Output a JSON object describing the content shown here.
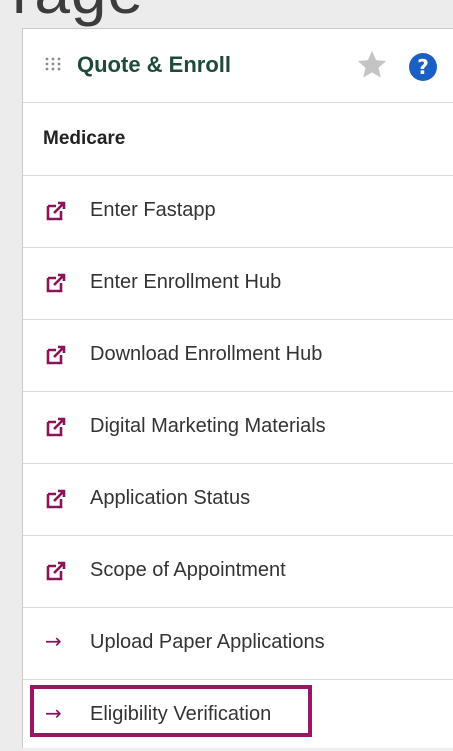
{
  "top_fragment": "rage",
  "widget": {
    "title": "Quote & Enroll",
    "section_label": "Medicare",
    "help_glyph": "?",
    "grip_icon": "grip-dots-icon",
    "star_icon": "star-icon",
    "help_icon": "help-circle-icon"
  },
  "items": [
    {
      "label": "Enter Fastapp",
      "icon": "external-link-icon"
    },
    {
      "label": "Enter Enrollment Hub",
      "icon": "external-link-icon"
    },
    {
      "label": "Download Enrollment Hub",
      "icon": "external-link-icon"
    },
    {
      "label": "Digital Marketing Materials",
      "icon": "external-link-icon"
    },
    {
      "label": "Application Status",
      "icon": "external-link-icon"
    },
    {
      "label": "Scope of Appointment",
      "icon": "external-link-icon"
    },
    {
      "label": "Upload Paper Applications",
      "icon": "arrow-right-icon",
      "arrow_glyph": "→"
    },
    {
      "label": "Eligibility Verification",
      "icon": "arrow-right-icon",
      "arrow_glyph": "→"
    }
  ],
  "colors": {
    "accent": "#8a1457",
    "title": "#1f4a3b",
    "help": "#1a5fc4",
    "highlight": "#9c1565"
  }
}
